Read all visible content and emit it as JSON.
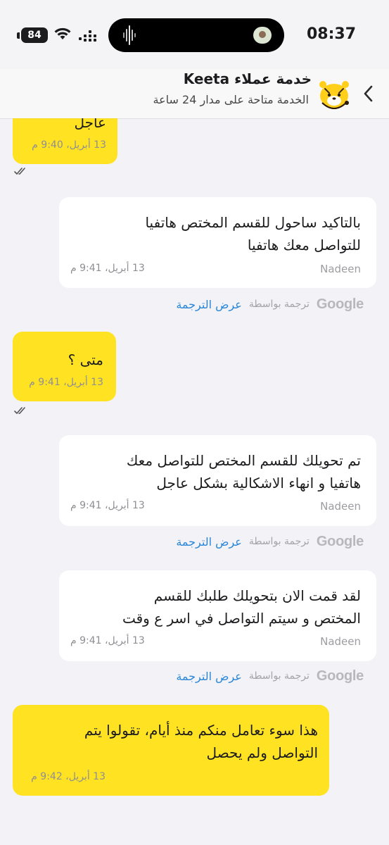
{
  "status_bar": {
    "time": "08:37",
    "battery": "84"
  },
  "header": {
    "title": "خدمة عملاء Keeta",
    "subtitle": "الخدمة متاحة على مدار 24 ساعة"
  },
  "messages": [
    {
      "sender": "user",
      "text": "عاجل",
      "time": "13 أبريل، 9:40 م",
      "read": true
    },
    {
      "sender": "agent",
      "agent_name": "Nadeen",
      "lines": [
        "بالتاكيد ساحول للقسم المختص هاتفيا",
        "للتواصل معك هاتفيا"
      ],
      "time": "13 أبريل، 9:41 م"
    },
    {
      "sender": "user",
      "text": "متى ؟",
      "time": "13 أبريل، 9:41 م",
      "read": true
    },
    {
      "sender": "agent",
      "agent_name": "Nadeen",
      "lines": [
        "تم تحويلك للقسم المختص للتواصل معك",
        "هاتفيا و انهاء الاشكالية بشكل عاجل"
      ],
      "time": "13 أبريل، 9:41 م"
    },
    {
      "sender": "agent",
      "agent_name": "Nadeen",
      "lines": [
        "لقد قمت الان بتحويلك طلبك للقسم",
        "المختص و سيتم التواصل في اسر ع وقت"
      ],
      "time": "13 أبريل، 9:41 م"
    },
    {
      "sender": "user",
      "lines": [
        "هذا سوء تعامل منكم منذ أيام، تقولوا يتم",
        "التواصل ولم يحصل"
      ],
      "time": "13 أبريل، 9:42 م"
    }
  ],
  "translation": {
    "show_label": "عرض الترجمة",
    "by_label": "ترجمة بواسطة",
    "provider": "Google"
  },
  "icons": {
    "back": "chevron-left-icon",
    "avatar": "keeta-mascot-icon",
    "read": "double-check-icon"
  },
  "colors": {
    "user_bubble": "#ffe322",
    "agent_bubble": "#ffffff",
    "background": "#f2f2f7",
    "link": "#2a86d8"
  }
}
